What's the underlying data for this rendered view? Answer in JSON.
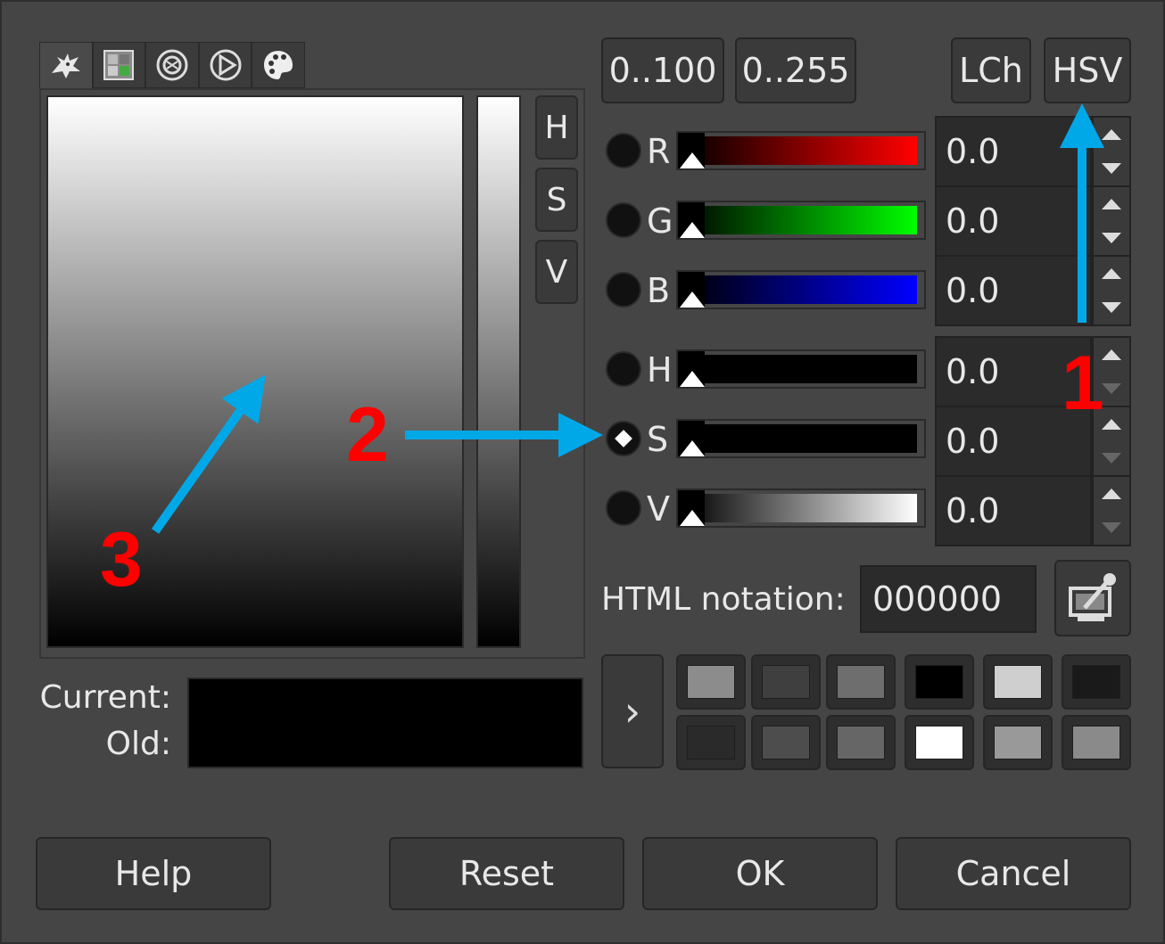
{
  "tabs": [
    {
      "icon": "gimp-wilber-icon",
      "active": true
    },
    {
      "icon": "cmyk-icon",
      "active": false
    },
    {
      "icon": "color-wheel-icon",
      "active": false
    },
    {
      "icon": "triangle-icon",
      "active": false
    },
    {
      "icon": "palette-icon",
      "active": false
    }
  ],
  "channel_buttons": [
    "H",
    "S",
    "V"
  ],
  "range_buttons": {
    "r100": "0..100",
    "r255": "0..255"
  },
  "model_buttons": {
    "lch": "LCh",
    "hsv": "HSV"
  },
  "rows": [
    {
      "label": "R",
      "value": "0.0",
      "gradient_end": "#ff0000"
    },
    {
      "label": "G",
      "value": "0.0",
      "gradient_end": "#00ff00"
    },
    {
      "label": "B",
      "value": "0.0",
      "gradient_end": "#0000ff"
    },
    {
      "label": "H",
      "value": "0.0",
      "gradient_end": "#000000"
    },
    {
      "label": "S",
      "value": "0.0",
      "gradient_end": "#000000",
      "selected": true
    },
    {
      "label": "V",
      "value": "0.0",
      "gradient_end": "#ffffff"
    }
  ],
  "html_notation": {
    "label": "HTML notation:",
    "value": "000000"
  },
  "history_arrow": "›",
  "history_swatches": [
    "#8c8c8c",
    "#3f3f3f",
    "#6e6e6e",
    "#000000",
    "#cfcfcf",
    "#1a1a1a",
    "#2a2a2a",
    "#4d4d4d",
    "#666666",
    "#ffffff",
    "#999999",
    "#8a8a8a"
  ],
  "preview": {
    "current_label": "Current:",
    "old_label": "Old:",
    "color": "#000000"
  },
  "bottom_buttons": {
    "help": "Help",
    "reset": "Reset",
    "ok": "OK",
    "cancel": "Cancel"
  },
  "callouts": {
    "one": "1",
    "two": "2",
    "three": "3"
  },
  "colors": {
    "callout_number": "#ff0000",
    "arrow": "#00a8e8",
    "background": "#454545"
  }
}
